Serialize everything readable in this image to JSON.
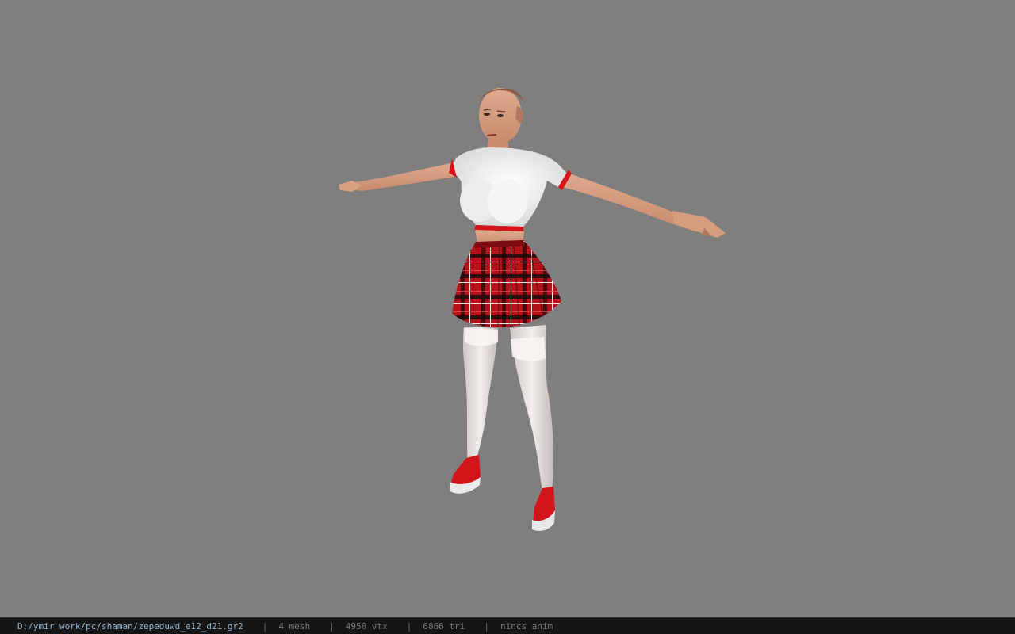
{
  "viewport": {
    "background_color": "#7f7f7f",
    "model_name": "zepeduwd_e12_d21"
  },
  "status_bar": {
    "file_path": "D:/ymir work/pc/shaman/zepeduwd_e12_d21.gr2",
    "separator": "|",
    "mesh_count": "4 mesh",
    "vertex_count": "4950 vtx",
    "triangle_count": "6866 tri",
    "anim_status": "nincs anim"
  },
  "colors": {
    "status_background": "#151515",
    "path_text": "#8fb6d6",
    "info_text": "#7a7a7a",
    "skirt_red": "#c0141c",
    "shirt_white": "#f2f2f2",
    "skin": "#d79f82"
  }
}
